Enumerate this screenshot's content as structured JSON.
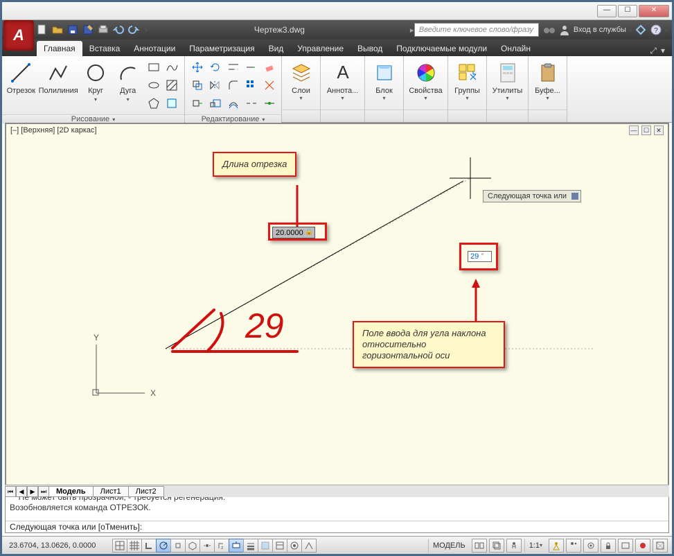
{
  "window": {
    "title": "Чертеж3.dwg",
    "search_placeholder": "Введите ключевое слово/фразу",
    "login_label": "Вход в службы"
  },
  "tabs": {
    "items": [
      "Главная",
      "Вставка",
      "Аннотации",
      "Параметризация",
      "Вид",
      "Управление",
      "Вывод",
      "Подключаемые модули",
      "Онлайн"
    ],
    "active": 0
  },
  "ribbon": {
    "draw": {
      "title": "Рисование",
      "line": "Отрезок",
      "polyline": "Полилиния",
      "circle": "Круг",
      "arc": "Дуга"
    },
    "edit": {
      "title": "Редактирование"
    },
    "layers": {
      "title": "Слои"
    },
    "annot": {
      "title": "Аннота..."
    },
    "block": {
      "title": "Блок"
    },
    "props": {
      "title": "Свойства"
    },
    "groups": {
      "title": "Группы"
    },
    "utils": {
      "title": "Утилиты"
    },
    "clip": {
      "title": "Буфе..."
    }
  },
  "viewport": {
    "label": "[–] [Верхняя] [2D каркас]",
    "ucs_x": "X",
    "ucs_y": "Y"
  },
  "dynamic": {
    "length_value": "20.0000",
    "angle_value": "29",
    "prompt": "Следующая точка или"
  },
  "callouts": {
    "length": "Длина отрезка",
    "angle": "Поле ввода для угла наклона относительно горизонтальной оси",
    "hand_angle": "29"
  },
  "model_tabs": {
    "items": [
      "Модель",
      "Лист1",
      "Лист2"
    ],
    "active": 0
  },
  "command": {
    "hist1": "** Не может быть прозрачной, - требуется регенерация.",
    "hist2": "Возобновляется команда ОТРЕЗОК.",
    "prompt": "Следующая точка или [оТменить]:"
  },
  "status": {
    "coords": "23.6704, 13.0626, 0.0000",
    "model": "МОДЕЛЬ",
    "scale": "1:1"
  }
}
